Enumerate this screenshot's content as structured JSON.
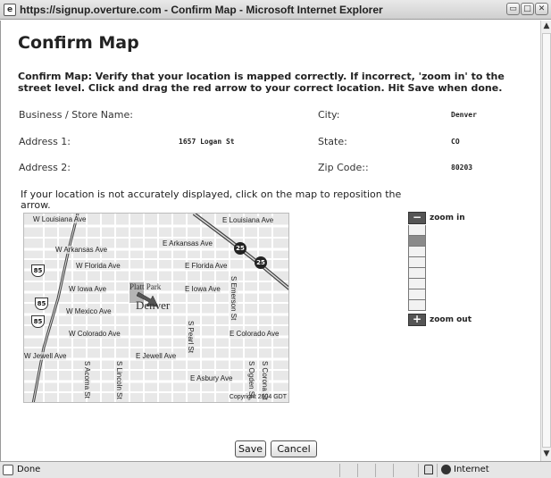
{
  "window": {
    "title": "https://signup.overture.com - Confirm Map - Microsoft Internet Explorer",
    "min_glyph": "▭",
    "max_glyph": "□",
    "close_glyph": "✕"
  },
  "page": {
    "title": "Confirm Map",
    "instructions": "Confirm Map: Verify that your location is mapped correctly. If incorrect, 'zoom in' to the street level. Click and drag the red arrow to your correct location. Hit Save when done."
  },
  "fields": {
    "business_label": "Business / Store Name:",
    "business_value": "",
    "city_label": "City:",
    "city_value": "Denver",
    "address1_label": "Address 1:",
    "address1_value": "1657 Logan St",
    "state_label": "State:",
    "state_value": "CO",
    "address2_label": "Address 2:",
    "address2_value": "",
    "zip_label": "Zip Code::",
    "zip_value": "80203"
  },
  "map": {
    "hint": "If your location is not accurately displayed, click on the map to reposition the arrow.",
    "city": "Denver",
    "park": "Platt Park",
    "copyright": "Copyright 2004 GDT",
    "streets": {
      "w_louisiana": "W Louisiana Ave",
      "e_louisiana": "E Louisiana Ave",
      "w_arkansas": "W Arkansas Ave",
      "e_arkansas": "E Arkansas Ave",
      "w_florida": "W Florida Ave",
      "e_florida": "E Florida Ave",
      "w_iowa": "W Iowa Ave",
      "e_iowa": "E Iowa Ave",
      "w_mexico": "W Mexico Ave",
      "w_colorado": "W Colorado Ave",
      "e_colorado": "E Colorado Ave",
      "w_jewell": "W Jewell Ave",
      "e_jewell": "E Jewell Ave",
      "e_asbury": "E Asbury Ave",
      "s_emerson": "S Emerson St",
      "s_pearl": "S Pearl St",
      "s_acoma": "S Acoma St",
      "s_lincoln": "S Lincoln St",
      "s_ogden": "S Ogden St",
      "s_corona": "S Corona St"
    },
    "shields": {
      "i25": "25",
      "us85": "85"
    },
    "icons": [
      "map-arrow-icon",
      "interstate-shield-icon",
      "us-route-shield-icon"
    ]
  },
  "zoom": {
    "in_label": "zoom in",
    "out_label": "zoom out",
    "in_glyph": "−",
    "out_glyph": "+",
    "levels": 8,
    "current_level": 1
  },
  "buttons": {
    "save": "Save",
    "cancel": "Cancel"
  },
  "scrollbar": {
    "up_glyph": "▲",
    "down_glyph": "▼"
  },
  "status": {
    "text": "Done",
    "zone": "Internet"
  },
  "colors": {
    "map_bg": "#e8e8e8",
    "arrow": "#555555",
    "highway": "#444444"
  }
}
